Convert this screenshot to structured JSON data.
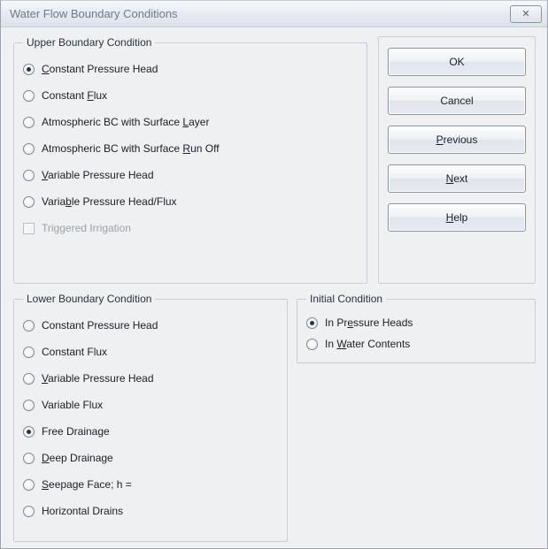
{
  "window": {
    "title": "Water Flow Boundary Conditions"
  },
  "buttons": {
    "ok": "OK",
    "cancel": "Cancel",
    "previous_pre": "P",
    "previous_post": "revious",
    "next_pre": "N",
    "next_post": "ext",
    "help_pre": "H",
    "help_post": "elp"
  },
  "upper": {
    "legend": "Upper Boundary Condition",
    "opt1_pre": "C",
    "opt1_post": "onstant Pressure Head",
    "opt2_pre": "Constant ",
    "opt2_mn": "F",
    "opt2_post": "lux",
    "opt3_pre": "Atmospheric BC with Surface ",
    "opt3_mn": "L",
    "opt3_post": "ayer",
    "opt4_pre": "Atmospheric BC with Surface ",
    "opt4_mn": "R",
    "opt4_post": "un Off",
    "opt5_pre": "V",
    "opt5_post": "ariable Pressure Head",
    "opt6_pre": "Varia",
    "opt6_mn": "b",
    "opt6_post": "le Pressure Head/Flux",
    "check1": "Triggered Irrigation",
    "selected": "opt1"
  },
  "lower": {
    "legend": "Lower Boundary Condition",
    "opt1": "Constant Pressure Head",
    "opt2": "Constant Flux",
    "opt3_pre": "V",
    "opt3_post": "ariable Pressure Head",
    "opt4": "Variable Flux",
    "opt5": "Free Drainage",
    "opt6_pre": "D",
    "opt6_post": "eep Drainage",
    "opt7_pre": "S",
    "opt7_post": "eepage Face; h =",
    "opt8": "Horizontal Drains",
    "selected": "opt5"
  },
  "initial": {
    "legend": "Initial Condition",
    "opt1_pre": "In Pr",
    "opt1_mn": "e",
    "opt1_post": "ssure Heads",
    "opt2_pre": "In ",
    "opt2_mn": "W",
    "opt2_post": "ater Contents",
    "selected": "opt1"
  }
}
